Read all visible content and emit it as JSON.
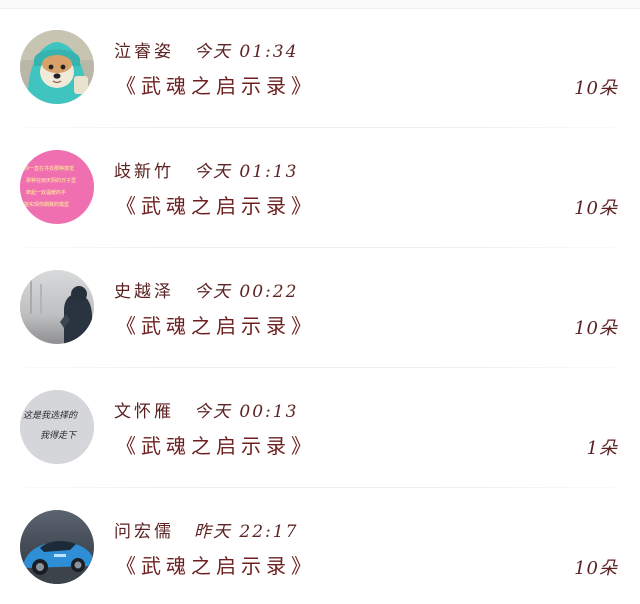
{
  "rows": [
    {
      "name": "泣睿姿",
      "time": "今天 01:34",
      "title": "《武魂之启示录》",
      "count": "10朵",
      "avatar": "dog-in-hoodie-avatar"
    },
    {
      "name": "歧新竹",
      "time": "今天 01:13",
      "title": "《武魂之启示录》",
      "count": "10朵",
      "avatar": "pink-text-avatar",
      "avatar_lines": [
        "你一直在寻找那种感觉",
        "那种在雨天阴的日子里",
        "牵起一双温暖的手",
        "能实现你期冀的模型"
      ]
    },
    {
      "name": "史越泽",
      "time": "今天 00:22",
      "title": "《武魂之启示录》",
      "count": "10朵",
      "avatar": "foggy-figure-avatar"
    },
    {
      "name": "文怀雁",
      "time": "今天 00:13",
      "title": "《武魂之启示录》",
      "count": "1朵",
      "avatar": "handwriting-avatar",
      "avatar_lines": [
        "这是我选择的",
        "我得走下"
      ]
    },
    {
      "name": "问宏儒",
      "time": "昨天 22:17",
      "title": "《武魂之启示录》",
      "count": "10朵",
      "avatar": "blue-car-avatar"
    }
  ],
  "colors": {
    "text": "#6b2222",
    "background": "#ffffff",
    "pink": "#f06fb0"
  }
}
